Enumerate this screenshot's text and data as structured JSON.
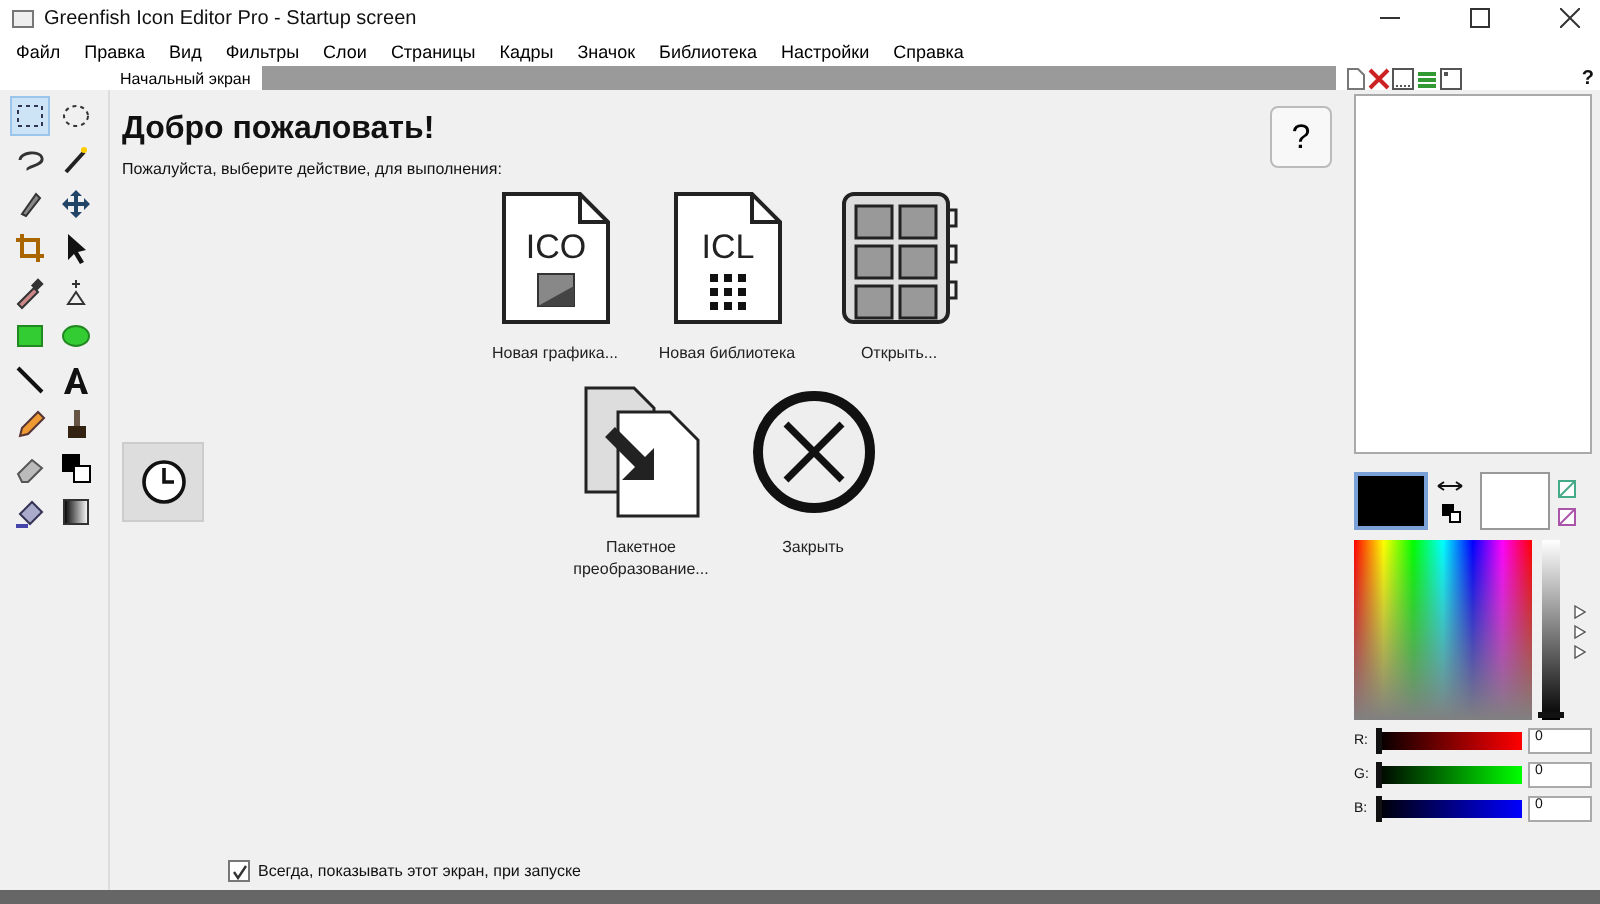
{
  "window": {
    "title": "Greenfish Icon Editor Pro - Startup screen"
  },
  "menu": [
    "Файл",
    "Правка",
    "Вид",
    "Фильтры",
    "Слои",
    "Страницы",
    "Кадры",
    "Значок",
    "Библиотека",
    "Настройки",
    "Справка"
  ],
  "tabs": [
    {
      "label": "Начальный экран",
      "selected": true
    }
  ],
  "tools": [
    {
      "selected": true
    },
    {
      "selected": false
    },
    {
      "selected": false
    },
    {
      "selected": false
    },
    {
      "selected": false
    },
    {
      "selected": false
    },
    {
      "selected": false
    },
    {
      "selected": false
    },
    {
      "selected": false
    },
    {
      "selected": false
    },
    {
      "selected": false
    },
    {
      "selected": false
    },
    {
      "selected": false
    },
    {
      "selected": false
    },
    {
      "selected": false
    },
    {
      "selected": false
    },
    {
      "selected": false
    },
    {
      "selected": false
    },
    {
      "selected": false
    },
    {
      "selected": false
    }
  ],
  "welcome": {
    "heading": "Добро пожаловать!",
    "subtitle": "Пожалуйста, выберите действие, для выполнения:",
    "help": "?"
  },
  "actions": [
    {
      "kind": "ico",
      "label": "Новая графика...",
      "icon_text": "ICO"
    },
    {
      "kind": "icl",
      "label": "Новая библиотека",
      "icon_text": "ICL"
    },
    {
      "kind": "open",
      "label": "Открыть..."
    },
    {
      "kind": "batch",
      "label": "Пакетное преобразование..."
    },
    {
      "kind": "close",
      "label": "Закрыть"
    }
  ],
  "startup_checkbox": {
    "label": "Всегда, показывать этот экран, при запуске",
    "checked": true
  },
  "panel_help": "?",
  "lightness": {
    "level": 0
  },
  "channels": [
    {
      "label": "R:",
      "value": "0",
      "level": 0
    },
    {
      "label": "G:",
      "value": "0",
      "level": 0
    },
    {
      "label": "B:",
      "value": "0",
      "level": 0
    }
  ]
}
